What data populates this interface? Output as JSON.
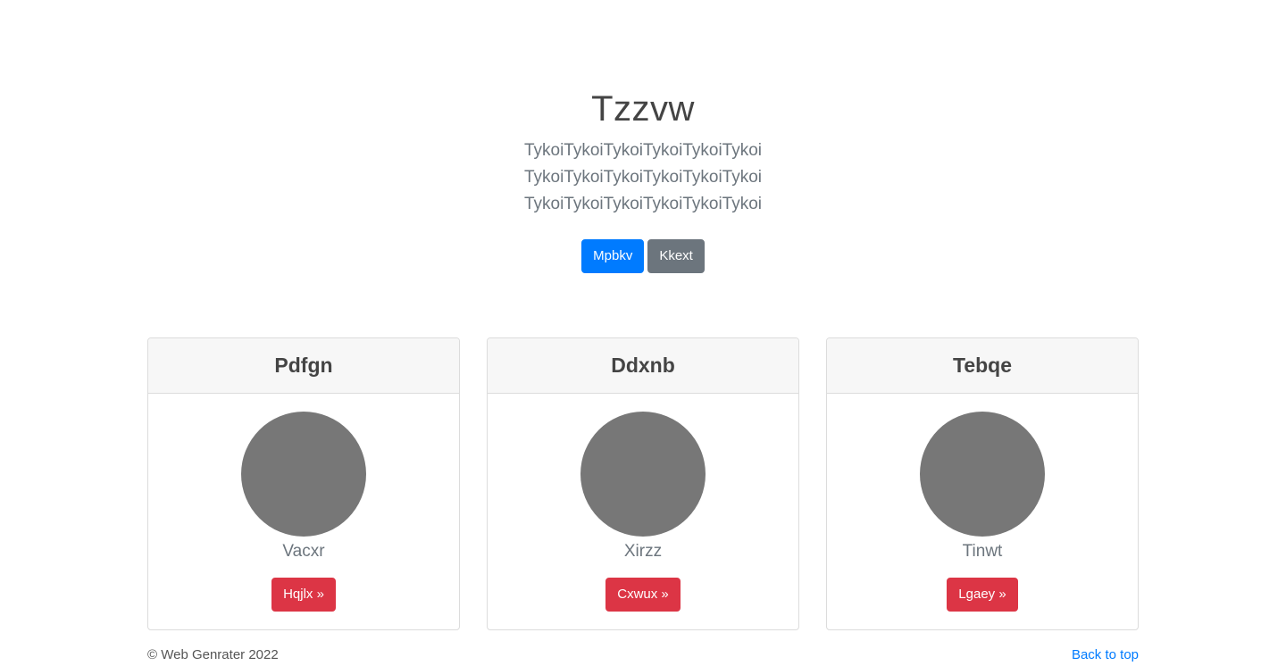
{
  "hero": {
    "title": "Tzzvw",
    "lead": "TykoiTykoiTykoiTykoiTykoiTykoi TykoiTykoiTykoiTykoiTykoiTykoi TykoiTykoiTykoiTykoiTykoiTykoi",
    "primary_button": "Mpbkv",
    "secondary_button": "Kkext"
  },
  "cards": [
    {
      "title": "Pdfgn",
      "name": "Vacxr",
      "button": "Hqjlx »"
    },
    {
      "title": "Ddxnb",
      "name": "Xirzz",
      "button": "Cxwux »"
    },
    {
      "title": "Tebqe",
      "name": "Tinwt",
      "button": "Lgaey »"
    }
  ],
  "footer": {
    "copyright": "© Web Genrater 2022",
    "back_to_top": "Back to top"
  },
  "colors": {
    "primary": "#007bff",
    "secondary": "#6c757d",
    "danger": "#dc3545",
    "avatar": "#777777"
  }
}
